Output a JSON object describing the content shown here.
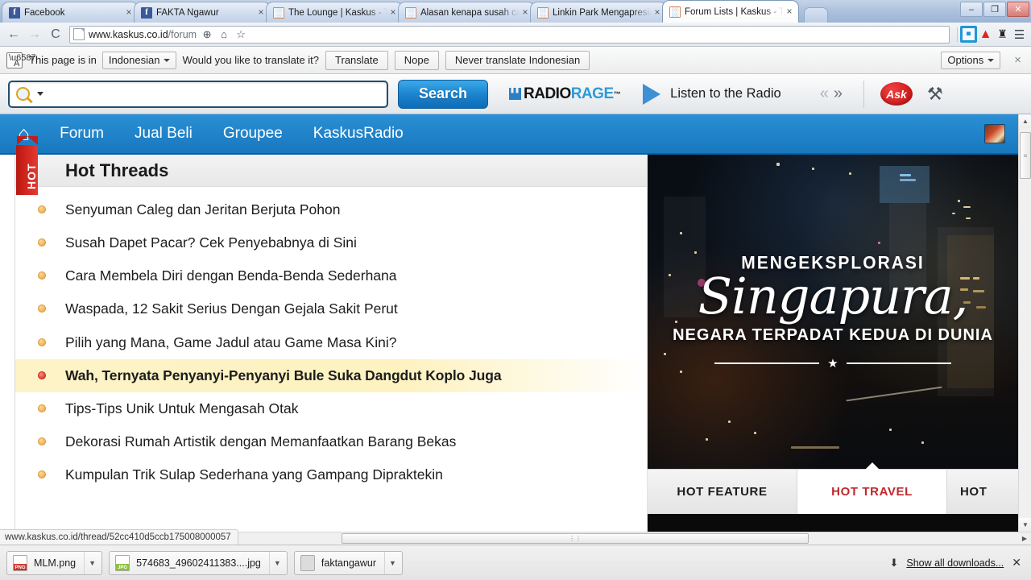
{
  "browser": {
    "tabs": [
      {
        "title": "Facebook",
        "favicon": "facebook-icon",
        "active": false
      },
      {
        "title": "FAKTA Ngawur",
        "favicon": "facebook-icon",
        "active": false
      },
      {
        "title": "The Lounge | Kaskus - The",
        "favicon": "kaskus-icon",
        "active": false
      },
      {
        "title": "Alasan kenapa susah cari",
        "favicon": "kaskus-icon",
        "active": false
      },
      {
        "title": "Linkin Park Mengapresiasi",
        "favicon": "kaskus-icon",
        "active": false
      },
      {
        "title": "Forum Lists | Kaskus - The",
        "favicon": "kaskus-icon",
        "active": true
      }
    ],
    "tab_close_label": "×",
    "window_controls": {
      "minimize": "–",
      "maximize": "❐",
      "close": "✕"
    },
    "back_label": "←",
    "forward_label": "→",
    "reload_label": "C",
    "url_bold": "www.kaskus.co.id",
    "url_rest": "/forum",
    "omni_actions": {
      "zoom": "⊕",
      "home": "⌂",
      "bookmark": "☆"
    },
    "extensions": [
      {
        "name": "grid-extension-icon",
        "glyph": ""
      },
      {
        "name": "adobe-triangle-icon",
        "glyph": "▲"
      },
      {
        "name": "magic-hat-icon",
        "glyph": "♜"
      },
      {
        "name": "chrome-menu-icon",
        "glyph": "☰"
      }
    ]
  },
  "translate_bar": {
    "prefix": "This page is in",
    "language": "Indonesian",
    "question": "Would you like to translate it?",
    "translate_label": "Translate",
    "nope_label": "Nope",
    "never_label": "Never translate Indonesian",
    "options_label": "Options",
    "close_label": "×"
  },
  "ask_toolbar": {
    "search_value": "",
    "search_placeholder": "",
    "search_button": "Search",
    "brand_radio": "RADIO",
    "brand_rage": "RAGE",
    "brand_tm": "™",
    "listen_label": "Listen to the Radio",
    "prev_label": "«",
    "next_label": "»",
    "ask_logo_label": "Ask",
    "tools_label": "⚒"
  },
  "kaskus": {
    "nav": [
      {
        "label": "Forum"
      },
      {
        "label": "Jual Beli"
      },
      {
        "label": "Groupee"
      },
      {
        "label": "KaskusRadio"
      }
    ],
    "home_icon": "⌂",
    "hot_threads": {
      "ribbon_label": "HOT",
      "title": "Hot Threads",
      "items": [
        {
          "text": "Senyuman Caleg dan Jeritan Berjuta Pohon",
          "active": false
        },
        {
          "text": "Susah Dapet Pacar? Cek Penyebabnya di Sini",
          "active": false
        },
        {
          "text": "Cara Membela Diri dengan Benda-Benda Sederhana",
          "active": false
        },
        {
          "text": "Waspada, 12 Sakit Serius Dengan Gejala Sakit Perut",
          "active": false
        },
        {
          "text": "Pilih yang Mana, Game Jadul atau Game Masa Kini?",
          "active": false
        },
        {
          "text": "Wah, Ternyata Penyanyi-Penyanyi Bule Suka Dangdut Koplo Juga",
          "active": true
        },
        {
          "text": "Tips-Tips Unik Untuk Mengasah Otak",
          "active": false
        },
        {
          "text": "Dekorasi Rumah Artistik dengan Memanfaatkan Barang Bekas",
          "active": false
        },
        {
          "text": "Kumpulan Trik Sulap Sederhana yang Gampang Dipraktekin",
          "active": false
        }
      ]
    },
    "promo": {
      "arch_text": "MENGEKSPLORASI",
      "script_text": "Singapura,",
      "subtitle": "NEGARA TERPADAT KEDUA DI DUNIA",
      "star": "★",
      "tabs": [
        {
          "label": "HOT FEATURE",
          "active": false
        },
        {
          "label": "HOT TRAVEL",
          "active": true
        },
        {
          "label": "HOT",
          "active": false
        }
      ],
      "accent_color": "#c0272d"
    }
  },
  "status_bar": {
    "url": "www.kaskus.co.id/thread/52cc410d5ccb175008000057"
  },
  "downloads": {
    "items": [
      {
        "name": "MLM.png",
        "type": "png"
      },
      {
        "name": "574683_49602411383....jpg",
        "type": "jpg"
      },
      {
        "name": "faktangawur",
        "type": "folder"
      }
    ],
    "show_all_label": "Show all downloads...",
    "close_label": "✕",
    "arrow": "⬇"
  }
}
